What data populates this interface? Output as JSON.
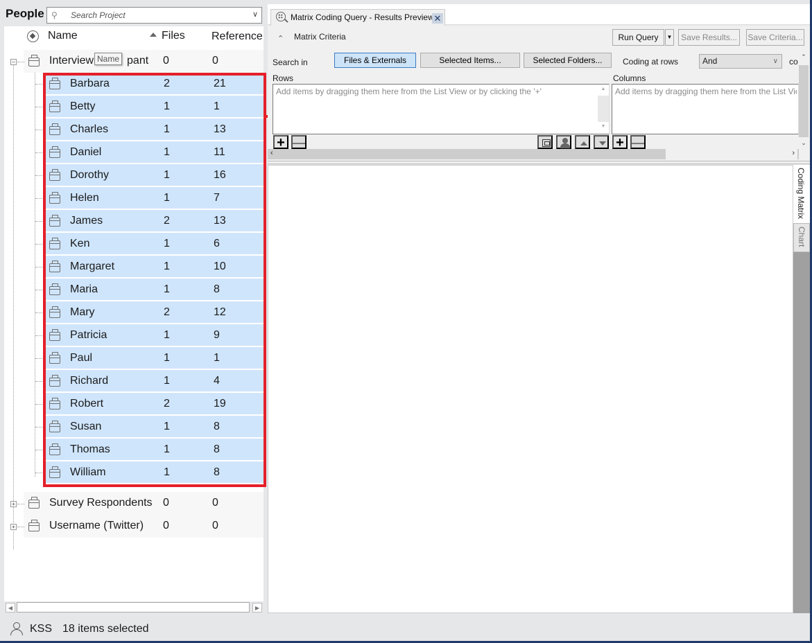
{
  "left_panel": {
    "title": "People",
    "search": {
      "placeholder": "Search Project",
      "value": ""
    },
    "columns": {
      "name": "Name",
      "files": "Files",
      "references": "Reference"
    },
    "tooltip": "Name",
    "parents": [
      {
        "name": "Interview Participant",
        "display_name": "Interview",
        "display_suffix": "pant",
        "files": "0",
        "references": "0",
        "expanded": true
      },
      {
        "name": "Survey Respondents",
        "files": "0",
        "references": "0",
        "expanded": false
      },
      {
        "name": "Username (Twitter)",
        "files": "0",
        "references": "0",
        "expanded": false
      }
    ],
    "children": [
      {
        "name": "Barbara",
        "files": "2",
        "references": "21"
      },
      {
        "name": "Betty",
        "files": "1",
        "references": "1"
      },
      {
        "name": "Charles",
        "files": "1",
        "references": "13"
      },
      {
        "name": "Daniel",
        "files": "1",
        "references": "11"
      },
      {
        "name": "Dorothy",
        "files": "1",
        "references": "16"
      },
      {
        "name": "Helen",
        "files": "1",
        "references": "7"
      },
      {
        "name": "James",
        "files": "2",
        "references": "13"
      },
      {
        "name": "Ken",
        "files": "1",
        "references": "6"
      },
      {
        "name": "Margaret",
        "files": "1",
        "references": "10"
      },
      {
        "name": "Maria",
        "files": "1",
        "references": "8"
      },
      {
        "name": "Mary",
        "files": "2",
        "references": "12"
      },
      {
        "name": "Patricia",
        "files": "1",
        "references": "9"
      },
      {
        "name": "Paul",
        "files": "1",
        "references": "1"
      },
      {
        "name": "Richard",
        "files": "1",
        "references": "4"
      },
      {
        "name": "Robert",
        "files": "2",
        "references": "19"
      },
      {
        "name": "Susan",
        "files": "1",
        "references": "8"
      },
      {
        "name": "Thomas",
        "files": "1",
        "references": "8"
      },
      {
        "name": "William",
        "files": "1",
        "references": "8"
      }
    ]
  },
  "status_bar": {
    "user": "KSS",
    "selection": "18 items selected"
  },
  "right_panel": {
    "tab": {
      "title": "Matrix Coding Query - Results Preview",
      "close": "✕"
    },
    "criteria": {
      "title": "Matrix Criteria",
      "run_query": "Run Query",
      "save_results": "Save Results...",
      "save_criteria": "Save Criteria...",
      "search_in_label": "Search in",
      "search_in_options": [
        "Files & Externals",
        "Selected Items...",
        "Selected Folders..."
      ],
      "search_in_selected": "Files & Externals",
      "coding_at_rows_label": "Coding at rows",
      "coding_operator": "And",
      "truncated_label": "co",
      "rows_label": "Rows",
      "columns_label": "Columns",
      "rows_placeholder": "Add items by dragging them here from the List View or by clicking the '+'",
      "columns_placeholder": "Add items by dragging them here from the List View"
    },
    "side_tabs": [
      "Coding Matrix",
      "Chart"
    ],
    "active_side_tab": "Coding Matrix"
  },
  "colors": {
    "selection": "#cfe5fc",
    "highlight_border": "#e4202a",
    "active_button": "#cde3f7"
  }
}
